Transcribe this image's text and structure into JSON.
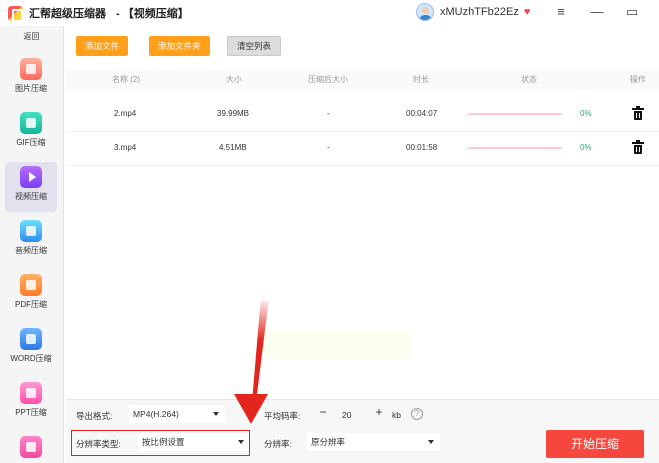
{
  "titlebar": {
    "app_name": "汇帮超级压缩器",
    "subtitle": "- 【视频压缩】",
    "username": "xMUzhTFb22Ez",
    "vip_icon": "heart-shield-icon",
    "controls": {
      "menu": "≡",
      "minimize": "—",
      "maximize": "▭"
    }
  },
  "sidebar": {
    "back_label": "返回",
    "items": [
      {
        "label": "图片压缩",
        "icon": "image-icon"
      },
      {
        "label": "GIF压缩",
        "icon": "gif-icon"
      },
      {
        "label": "视频压缩",
        "icon": "video-icon",
        "active": true
      },
      {
        "label": "音频压缩",
        "icon": "audio-icon"
      },
      {
        "label": "PDF压缩",
        "icon": "pdf-icon"
      },
      {
        "label": "WORD压缩",
        "icon": "word-icon"
      },
      {
        "label": "PPT压缩",
        "icon": "ppt-icon"
      }
    ]
  },
  "toolbar": {
    "add_file": "添加文件",
    "add_folder": "添加文件夹",
    "clear_list": "清空列表"
  },
  "table": {
    "headers": {
      "name": "名称 (2)",
      "size": "大小",
      "compressed_size": "压缩后大小",
      "duration": "时长",
      "status": "状态",
      "action": "操作"
    },
    "rows": [
      {
        "name": "2.mp4",
        "size": "39.99MB",
        "compressed_size": "-",
        "duration": "00:04:07",
        "progress": 0,
        "percent": "0%"
      },
      {
        "name": "3.mp4",
        "size": "4.51MB",
        "compressed_size": "-",
        "duration": "00:01:58",
        "progress": 0,
        "percent": "0%"
      }
    ]
  },
  "settings": {
    "export_format_label": "导出格式:",
    "export_format_value": "MP4(H.264)",
    "avg_bitrate_label": "平均码率:",
    "avg_bitrate_minus": "−",
    "avg_bitrate_value": "20",
    "avg_bitrate_plus": "+",
    "avg_bitrate_unit": "kb",
    "help": "?",
    "resolution_type_label": "分辨率类型:",
    "resolution_type_value": "按比例设置",
    "resolution_label": "分辨率:",
    "resolution_value": "原分辨率"
  },
  "start_button": "开始压缩",
  "colors": {
    "accent_orange": "#ff9f1a",
    "start_red": "#f5473e",
    "progress_pink": "#ff5a6e",
    "percent_green": "#27ae60",
    "annotation_red": "#e3251e"
  }
}
